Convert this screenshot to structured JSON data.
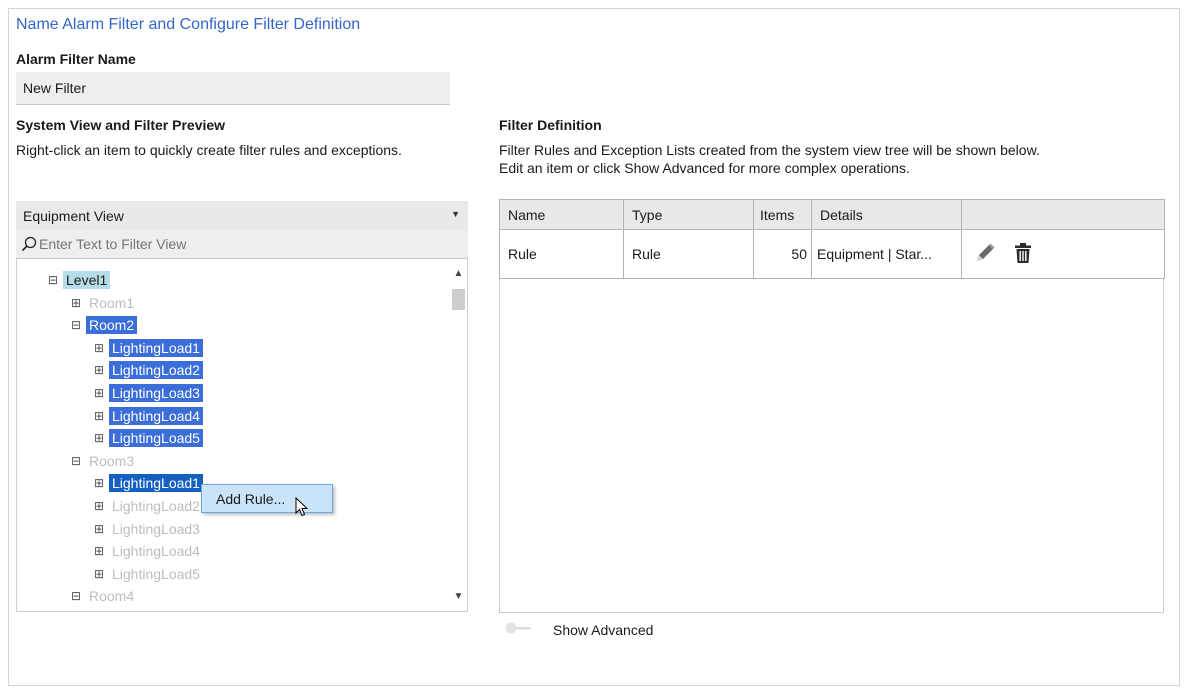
{
  "page_title": "Name Alarm Filter and Configure Filter Definition",
  "filter_name": {
    "label": "Alarm Filter Name",
    "value": "New Filter"
  },
  "system_view": {
    "heading": "System View and Filter Preview",
    "hint": "Right-click an item to quickly create filter rules and exceptions.",
    "view_select": "Equipment View",
    "filter_placeholder": "Enter Text to Filter View",
    "tree": [
      {
        "label": "Level1",
        "toggle": "⊟",
        "state": "highlight"
      },
      {
        "label": "Room1",
        "toggle": "⊞",
        "state": "dim"
      },
      {
        "label": "Room2",
        "toggle": "⊟",
        "state": "selected"
      },
      {
        "label": "LightingLoad1",
        "toggle": "⊞",
        "state": "selected"
      },
      {
        "label": "LightingLoad2",
        "toggle": "⊞",
        "state": "selected"
      },
      {
        "label": "LightingLoad3",
        "toggle": "⊞",
        "state": "selected"
      },
      {
        "label": "LightingLoad4",
        "toggle": "⊞",
        "state": "selected"
      },
      {
        "label": "LightingLoad5",
        "toggle": "⊞",
        "state": "selected"
      },
      {
        "label": "Room3",
        "toggle": "⊟",
        "state": "dim"
      },
      {
        "label": "LightingLoad1",
        "toggle": "⊞",
        "state": "focused"
      },
      {
        "label": "LightingLoad2",
        "toggle": "⊞",
        "state": "dim"
      },
      {
        "label": "LightingLoad3",
        "toggle": "⊞",
        "state": "dim"
      },
      {
        "label": "LightingLoad4",
        "toggle": "⊞",
        "state": "dim"
      },
      {
        "label": "LightingLoad5",
        "toggle": "⊞",
        "state": "dim"
      },
      {
        "label": "Room4",
        "toggle": "⊟",
        "state": "dim"
      }
    ],
    "context_menu": {
      "item": "Add Rule..."
    }
  },
  "filter_definition": {
    "heading": "Filter Definition",
    "hint_line1": "Filter Rules and Exception Lists created from the system view tree will be shown below.",
    "hint_line2": "Edit an item or click Show Advanced for more complex operations.",
    "columns": [
      "Name",
      "Type",
      "Items",
      "Details",
      ""
    ],
    "rows": [
      {
        "name": "Rule",
        "type": "Rule",
        "items": "50",
        "details": "Equipment | Star..."
      }
    ],
    "row_actions": [
      "pencil-icon",
      "trash-icon"
    ]
  },
  "show_advanced": {
    "label": "Show Advanced",
    "on": false
  },
  "colors": {
    "title": "#3466c9",
    "selection": "#3b6ed9",
    "highlight": "#b5dde8",
    "menu": "#c9e3f8"
  }
}
